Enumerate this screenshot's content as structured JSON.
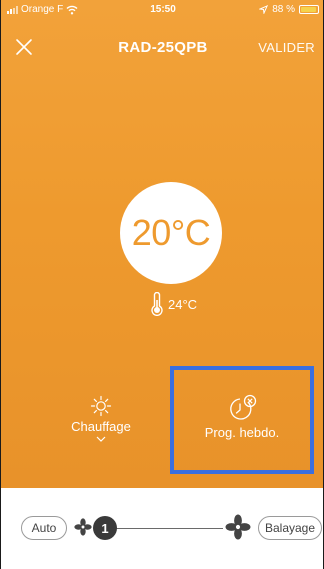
{
  "status_bar": {
    "carrier": "Orange F",
    "time": "15:50",
    "battery": "88 %",
    "icons": [
      "signal-icon",
      "wifi-icon",
      "location-icon",
      "battery-icon"
    ]
  },
  "header": {
    "title": "RAD-25QPB",
    "confirm_label": "VALIDER",
    "close_icon": "close-icon"
  },
  "temperature": {
    "setpoint": "20°C",
    "ambient": "24°C",
    "ambient_icon": "thermometer-icon"
  },
  "modes": {
    "heating_label": "Chauffage",
    "heating_icon": "sun-icon",
    "weekly_program_label": "Prog. hebdo.",
    "weekly_program_icon": "clock-cancel-icon"
  },
  "fan": {
    "auto_label": "Auto",
    "sweep_label": "Balayage",
    "speed_value": "1"
  },
  "colors": {
    "background": "#ee9a2e",
    "highlight": "#3a6fe0",
    "text_on_orange": "#ffffff"
  }
}
